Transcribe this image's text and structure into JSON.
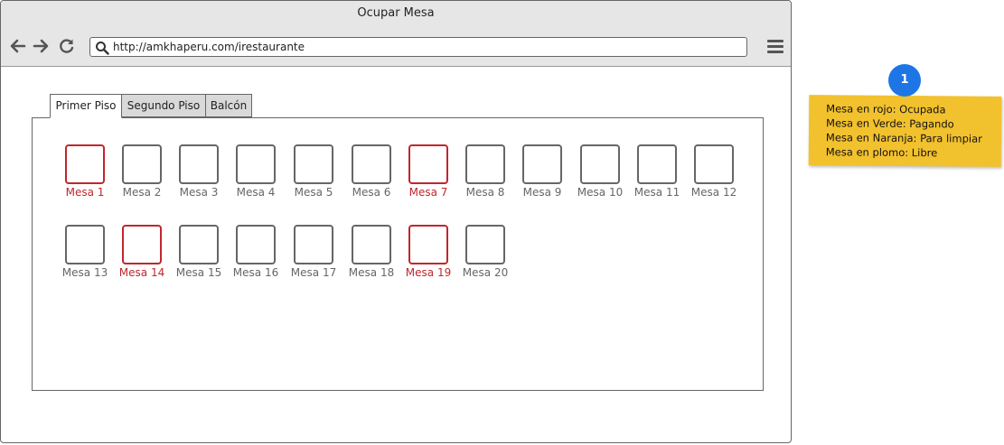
{
  "window": {
    "title": "Ocupar Mesa"
  },
  "toolbar": {
    "back_icon": "arrow-left",
    "forward_icon": "arrow-right",
    "reload_icon": "reload",
    "url": "http://amkhaperu.com/irestaurante",
    "menu_icon": "hamburger-menu"
  },
  "tabs": [
    {
      "label": "Primer Piso",
      "active": true
    },
    {
      "label": "Segundo Piso",
      "active": false
    },
    {
      "label": "Balcón",
      "active": false
    }
  ],
  "colors": {
    "occupied": "#c0272d",
    "free": "#666666",
    "note_bg": "#f2c12e",
    "badge": "#1e76e6"
  },
  "mesas": [
    {
      "label": "Mesa 1",
      "status": "ocupada"
    },
    {
      "label": "Mesa 2",
      "status": "libre"
    },
    {
      "label": "Mesa 3",
      "status": "libre"
    },
    {
      "label": "Mesa 4",
      "status": "libre"
    },
    {
      "label": "Mesa 5",
      "status": "libre"
    },
    {
      "label": "Mesa 6",
      "status": "libre"
    },
    {
      "label": "Mesa 7",
      "status": "ocupada"
    },
    {
      "label": "Mesa 8",
      "status": "libre"
    },
    {
      "label": "Mesa 9",
      "status": "libre"
    },
    {
      "label": "Mesa 10",
      "status": "libre"
    },
    {
      "label": "Mesa 11",
      "status": "libre"
    },
    {
      "label": "Mesa 12",
      "status": "libre"
    },
    {
      "label": "Mesa 13",
      "status": "libre"
    },
    {
      "label": "Mesa 14",
      "status": "ocupada"
    },
    {
      "label": "Mesa 15",
      "status": "libre"
    },
    {
      "label": "Mesa 16",
      "status": "libre"
    },
    {
      "label": "Mesa 17",
      "status": "libre"
    },
    {
      "label": "Mesa 18",
      "status": "libre"
    },
    {
      "label": "Mesa 19",
      "status": "ocupada"
    },
    {
      "label": "Mesa 20",
      "status": "libre"
    }
  ],
  "annotation": {
    "badge": "1",
    "lines": [
      "Mesa en rojo: Ocupada",
      "Mesa en Verde: Pagando",
      "Mesa en Naranja: Para limpiar",
      "Mesa en plomo: Libre"
    ]
  }
}
